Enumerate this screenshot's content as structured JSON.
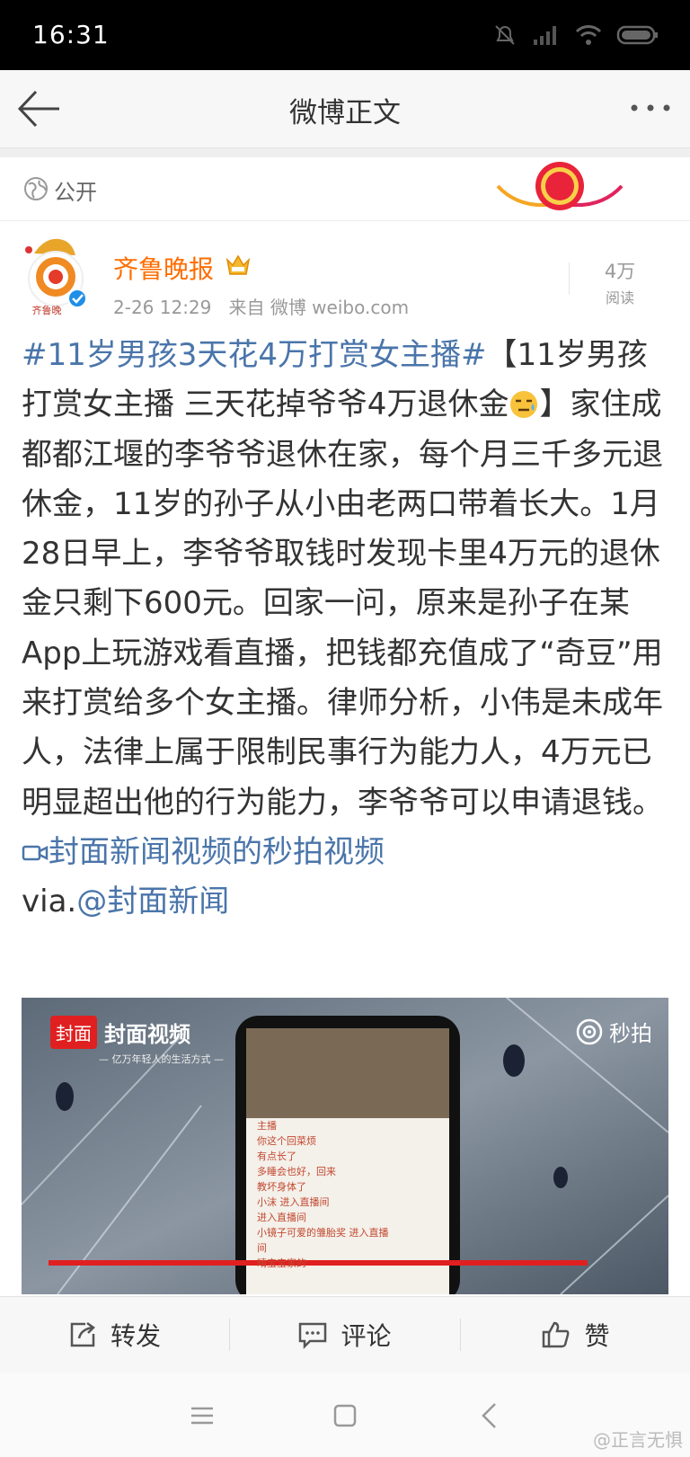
{
  "status_bar": {
    "time": "16:31"
  },
  "nav": {
    "title": "微博正文"
  },
  "visibility": {
    "label": "公开"
  },
  "author": {
    "name": "齐鲁晚报",
    "avatar_text": "齐鲁晚",
    "date": "2-26 12:29",
    "source": "来自 微博 weibo.com"
  },
  "reads": {
    "count": "4万",
    "label": "阅读"
  },
  "post": {
    "hashtag": "#11岁男孩3天花4万打赏女主播#",
    "part1": "【11岁男孩打赏女主播 三天花掉爷爷4万退休金",
    "part2": "】家住成都都江堰的李爷爷退休在家，每个月三千多元退休金，11岁的孙子从小由老两口带着长大。1月28日早上，李爷爷取钱时发现卡里4万元的退休金只剩下600元。回家一问，原来是孙子在某App上玩游戏看直播，把钱都充值成了“奇豆”用来打赏给多个女主播。律师分析，小伟是未成年人，法律上属于限制民事行为能力人，4万元已明显超出他的行为能力，李爷爷可以申请退钱。",
    "video_link": "封面新闻视频的秒拍视频",
    "via": "via.",
    "mention": "@封面新闻"
  },
  "video": {
    "logo_short": "封面",
    "brand": "封面视频",
    "tagline": "— 亿万年轻人的生活方式 —",
    "source_label": "秒拍",
    "chat_lines": [
      "主播",
      "你这个回菜烦",
      "有点长了",
      "多睡会也好，回来",
      "教坏身体了",
      "小沫 进入直播间",
      "进入直播间",
      "小镜子可爱的雏胎奖 进入直播",
      "间",
      "晴宝宝家的"
    ]
  },
  "actions": {
    "repost": "转发",
    "comment": "评论",
    "like": "赞"
  },
  "watermark": "@正言无惧"
}
